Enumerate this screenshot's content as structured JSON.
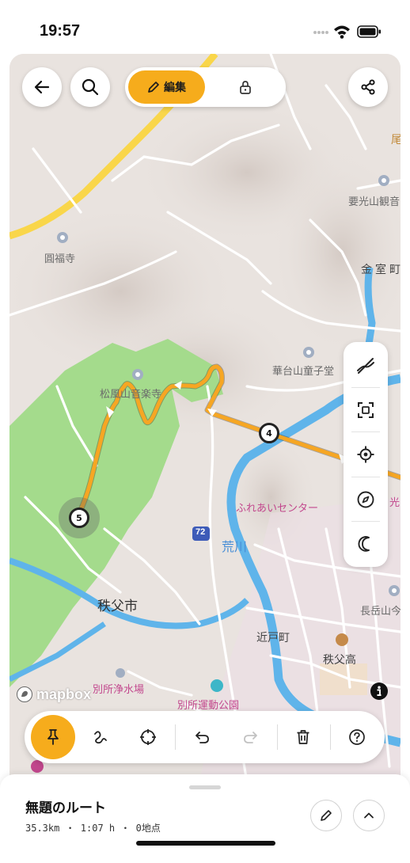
{
  "status_bar": {
    "time": "19:57"
  },
  "top_bar": {
    "mode_edit_label": "編集",
    "icons": [
      "back-arrow-icon",
      "search-icon",
      "pencil-icon",
      "lock-icon",
      "share-icon"
    ]
  },
  "map": {
    "labels": {
      "enpukuji": "圓福寺",
      "shofuzan": "松風山音楽寺",
      "kanonji": "要光山観音",
      "kanmuro": "金室町",
      "kadaisan": "華台山童子堂",
      "fureai": "ふれあいセンター",
      "arakawa": "荒川",
      "chichibu_city": "秩父市",
      "chichibu_high": "秩父高",
      "nagaoka": "長岳山今",
      "chikato": "近戸町",
      "jousui": "別所浄水場",
      "undo_koen": "別所運動公園",
      "route_72": "72",
      "kou": "光",
      "o": "尾"
    },
    "waypoints": [
      {
        "number": "4"
      },
      {
        "number": "5"
      }
    ],
    "colors": {
      "route": "#f6a623",
      "forest": "#9fd98a",
      "river": "#5fb4ea",
      "highway": "#f9d64a",
      "land": "#e9e3df"
    }
  },
  "right_tools": {
    "icons": [
      "route-snap-off-icon",
      "fit-bounds-icon",
      "locate-icon",
      "compass-icon",
      "night-mode-icon"
    ]
  },
  "attribution": {
    "logo_text": "mapbox"
  },
  "toolbar": {
    "icons": [
      "pin-icon",
      "freehand-icon",
      "crosshair-icon",
      "undo-icon",
      "redo-icon",
      "trash-icon",
      "help-icon"
    ]
  },
  "sheet": {
    "title": "無題のルート",
    "stats": "35.3km ・ 1:07 h ・ 0地点"
  }
}
